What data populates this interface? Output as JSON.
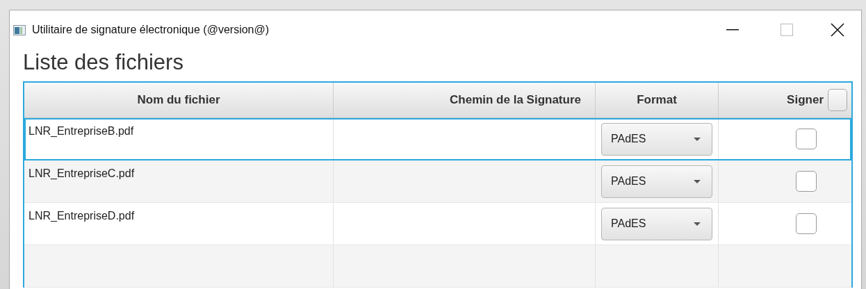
{
  "window": {
    "title": "Utilitaire de signature électronique (@version@)"
  },
  "heading": "Liste des fichiers",
  "table": {
    "columns": [
      {
        "label": "Nom du fichier",
        "kind": "text"
      },
      {
        "label": "Chemin de la Signature",
        "kind": "text"
      },
      {
        "label": "Format",
        "kind": "text"
      },
      {
        "label": "Signer",
        "kind": "check",
        "checked": false
      }
    ],
    "rows": [
      {
        "file": "LNR_EntrepriseB.pdf",
        "format": "PAdES",
        "sign": false,
        "selected": true
      },
      {
        "file": "LNR_EntrepriseC.pdf",
        "format": "PAdES",
        "sign": false,
        "selected": false
      },
      {
        "file": "LNR_EntrepriseD.pdf",
        "format": "PAdES",
        "sign": false,
        "selected": false
      }
    ]
  }
}
